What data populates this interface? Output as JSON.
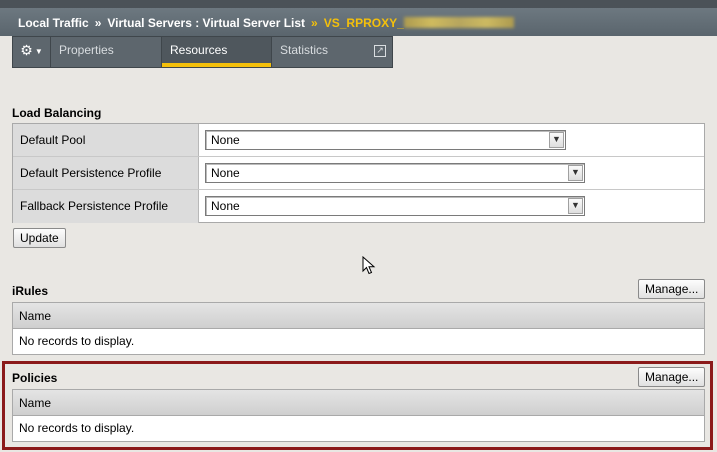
{
  "breadcrumb": {
    "items": [
      "Local Traffic",
      "Virtual Servers : Virtual Server List"
    ],
    "separator": "»",
    "current": "VS_RPROXY_"
  },
  "tabs": {
    "gear_icon": "gear-icon",
    "properties": "Properties",
    "resources": "Resources",
    "statistics": "Statistics",
    "active": "Resources"
  },
  "load_balancing": {
    "title": "Load Balancing",
    "rows": [
      {
        "label": "Default Pool",
        "value": "None"
      },
      {
        "label": "Default Persistence Profile",
        "value": "None"
      },
      {
        "label": "Fallback Persistence Profile",
        "value": "None"
      }
    ],
    "update_label": "Update"
  },
  "irules": {
    "title": "iRules",
    "manage_label": "Manage...",
    "column": "Name",
    "empty_text": "No records to display."
  },
  "policies": {
    "title": "Policies",
    "manage_label": "Manage...",
    "column": "Name",
    "empty_text": "No records to display."
  },
  "colors": {
    "header": "#5d666d",
    "accent": "#f4c00b",
    "highlight_border": "#8b1a1a"
  }
}
